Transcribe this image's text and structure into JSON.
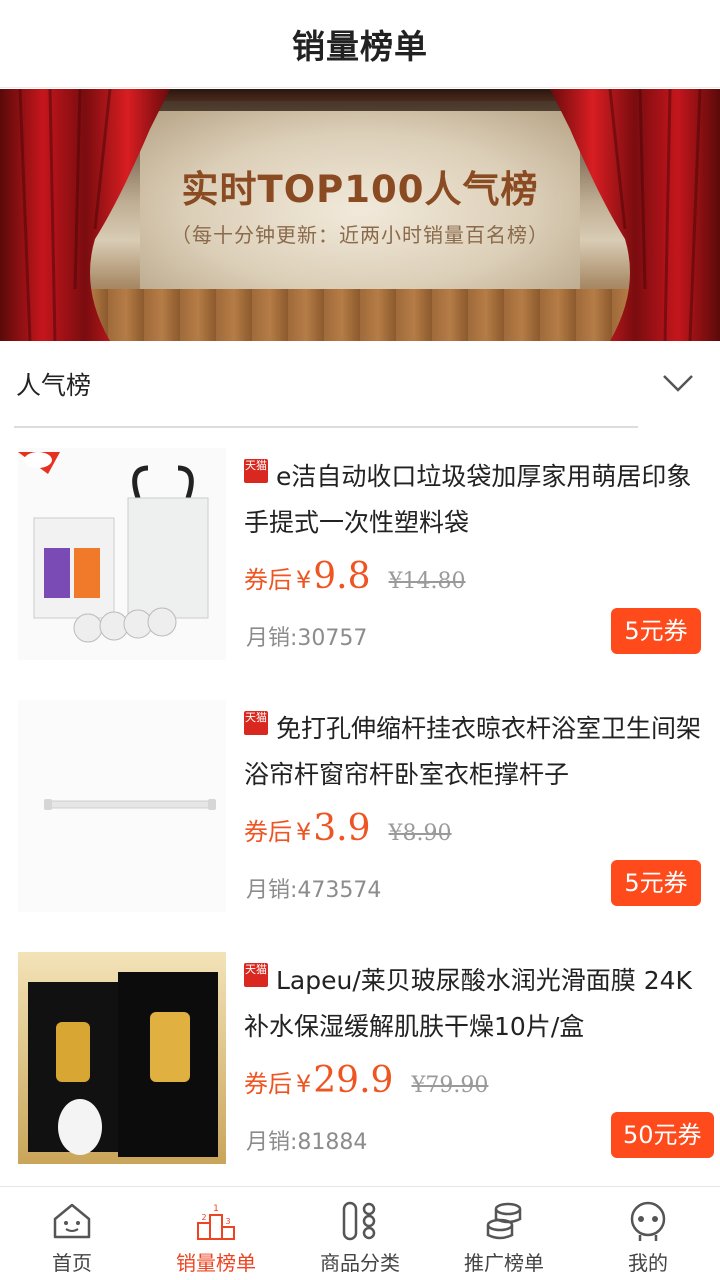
{
  "header": {
    "title": "销量榜单"
  },
  "banner": {
    "title": "实时TOP100人气榜",
    "subtitle": "（每十分钟更新：近两小时销量百名榜）"
  },
  "section": {
    "label": "人气榜",
    "chevron_icon": "chevron-down-icon"
  },
  "badge_text": "天猫",
  "products": [
    {
      "title": "e洁自动收口垃圾袋加厚家用萌居印象手提式一次性塑料袋",
      "price_prefix": "券后",
      "currency": "¥",
      "price": "9.8",
      "original_price": "¥14.80",
      "sales": "月销:30757",
      "coupon": "5元券"
    },
    {
      "title": "免打孔伸缩杆挂衣晾衣杆浴室卫生间架浴帘杆窗帘杆卧室衣柜撑杆子",
      "price_prefix": "券后",
      "currency": "¥",
      "price": "3.9",
      "original_price": "¥8.90",
      "sales": "月销:473574",
      "coupon": "5元券"
    },
    {
      "title": "Lapeu/莱贝玻尿酸水润光滑面膜 24K补水保湿缓解肌肤干燥10片/盒",
      "price_prefix": "券后",
      "currency": "¥",
      "price": "29.9",
      "original_price": "¥79.90",
      "sales": "月销:81884",
      "coupon": "50元券"
    }
  ],
  "bottom_nav": [
    {
      "label": "首页",
      "icon": "home-icon",
      "active": false
    },
    {
      "label": "销量榜单",
      "icon": "podium-icon",
      "active": true
    },
    {
      "label": "商品分类",
      "icon": "category-icon",
      "active": false
    },
    {
      "label": "推广榜单",
      "icon": "coins-icon",
      "active": false
    },
    {
      "label": "我的",
      "icon": "profile-icon",
      "active": false
    }
  ],
  "colors": {
    "accent": "#ee4422",
    "coupon_bg": "#ff4a1c",
    "price": "#ee5522"
  }
}
